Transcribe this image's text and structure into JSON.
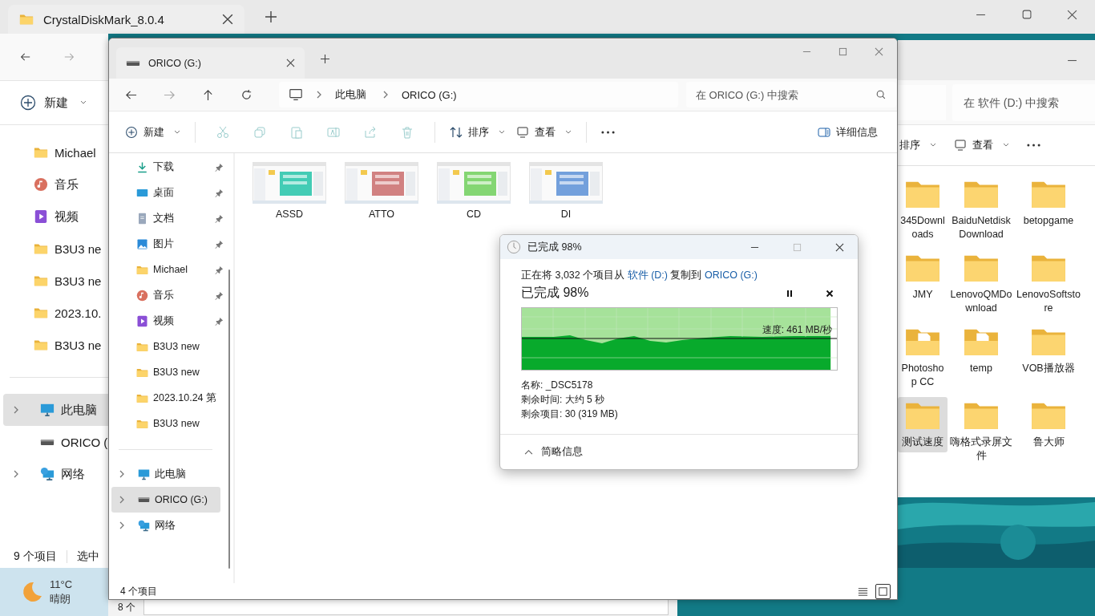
{
  "desktop_window": {
    "tab": {
      "title": "CrystalDiskMark_8.0.4"
    },
    "new_button": "新建",
    "quick_access": [
      {
        "label": "Michael",
        "kind": "folder"
      },
      {
        "label": "音乐",
        "kind": "music"
      },
      {
        "label": "视频",
        "kind": "video"
      },
      {
        "label": "B3U3 ne",
        "kind": "folder"
      },
      {
        "label": "B3U3 ne",
        "kind": "folder"
      },
      {
        "label": "2023.10.",
        "kind": "folder"
      },
      {
        "label": "B3U3 ne",
        "kind": "folder"
      }
    ],
    "tree": [
      {
        "label": "此电脑",
        "kind": "computer",
        "expandable": true,
        "selected": true
      },
      {
        "label": "ORICO (",
        "kind": "drive",
        "expandable": false,
        "selected": false
      },
      {
        "label": "网络",
        "kind": "network",
        "expandable": true,
        "selected": false
      }
    ],
    "status": {
      "count": "9 个项目",
      "selection": "选中"
    }
  },
  "taskbar": {
    "weather": {
      "temperature": "11°C",
      "condition": "晴朗"
    }
  },
  "lower_window": {
    "status": "8 个"
  },
  "drive_d_window": {
    "search": {
      "placeholder": "在 软件 (D:) 中搜索"
    },
    "toolbar": {
      "sort": "排序",
      "view": "查看"
    },
    "folders": [
      {
        "name": "345Downloads",
        "kind": "folder",
        "selected": false
      },
      {
        "name": "BaiduNetdiskDownload",
        "kind": "folder",
        "selected": false
      },
      {
        "name": "betopgame",
        "kind": "folder",
        "selected": false
      },
      {
        "name": "JMY",
        "kind": "folder",
        "selected": false
      },
      {
        "name": "LenovoQMDownload",
        "kind": "folder",
        "selected": false
      },
      {
        "name": "LenovoSoftstore",
        "kind": "folder",
        "selected": false
      },
      {
        "name": "Photoshop CC",
        "kind": "folder_with_files",
        "selected": false
      },
      {
        "name": "temp",
        "kind": "folder_with_files",
        "selected": false
      },
      {
        "name": "VOB播放器",
        "kind": "folder",
        "selected": false
      },
      {
        "name": "测试速度",
        "kind": "folder",
        "selected": true
      },
      {
        "name": "嗨格式录屏文件",
        "kind": "folder",
        "selected": false
      },
      {
        "name": "鲁大师",
        "kind": "folder",
        "selected": false
      }
    ]
  },
  "orico_window": {
    "tab": {
      "title": "ORICO (G:)"
    },
    "breadcrumb": [
      "此电脑",
      "ORICO (G:)"
    ],
    "search": {
      "placeholder": "在 ORICO (G:) 中搜索"
    },
    "toolbar": {
      "new": "新建",
      "sort": "排序",
      "view": "查看",
      "details": "详细信息"
    },
    "quick_access": [
      {
        "label": "下载",
        "kind": "download",
        "pinned": true
      },
      {
        "label": "桌面",
        "kind": "desktop",
        "pinned": true
      },
      {
        "label": "文档",
        "kind": "document",
        "pinned": true
      },
      {
        "label": "图片",
        "kind": "pictures",
        "pinned": true
      },
      {
        "label": "Michael",
        "kind": "folder",
        "pinned": true
      },
      {
        "label": "音乐",
        "kind": "music",
        "pinned": true
      },
      {
        "label": "视频",
        "kind": "video",
        "pinned": true
      },
      {
        "label": "B3U3 new",
        "kind": "folder",
        "pinned": false
      },
      {
        "label": "B3U3 new",
        "kind": "folder",
        "pinned": false
      },
      {
        "label": "2023.10.24 第",
        "kind": "folder",
        "pinned": false
      },
      {
        "label": "B3U3 new",
        "kind": "folder",
        "pinned": false
      }
    ],
    "tree": [
      {
        "label": "此电脑",
        "kind": "computer",
        "expandable": true,
        "selected": false
      },
      {
        "label": "ORICO (G:)",
        "kind": "drive",
        "expandable": true,
        "selected": true
      },
      {
        "label": "网络",
        "kind": "network",
        "expandable": true,
        "selected": false
      }
    ],
    "files": [
      {
        "name": "ASSD"
      },
      {
        "name": "ATTO"
      },
      {
        "name": "CD"
      },
      {
        "name": "DI"
      }
    ],
    "status": "4 个项目",
    "views": [
      {
        "kind": "details",
        "selected": false
      },
      {
        "kind": "tiles",
        "selected": true
      }
    ]
  },
  "copy_dialog": {
    "title": "已完成 98%",
    "description": {
      "prefix": "正在将 3,032 个项目从",
      "source": "软件 (D:)",
      "middle": "复制到",
      "destination": "ORICO (G:)"
    },
    "heading": "已完成 98%",
    "progress": {
      "level": 0.98,
      "speed": "速度: 461 MB/秒"
    },
    "details": [
      "名称: _DSC5178",
      "剩余时间: 大约 5 秒",
      "剩余项目: 30 (319 MB)"
    ],
    "toggle": "简略信息"
  }
}
